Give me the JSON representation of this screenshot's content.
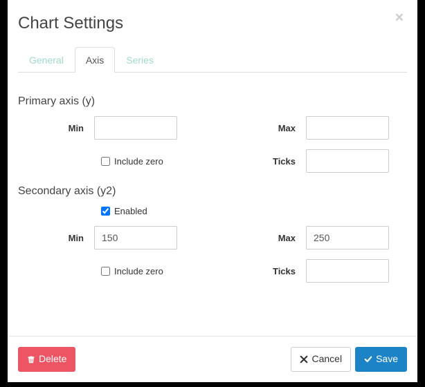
{
  "title": "Chart Settings",
  "tabs": {
    "general": "General",
    "axis": "Axis",
    "series": "Series",
    "active": "axis"
  },
  "primary": {
    "title": "Primary axis (y)",
    "min_label": "Min",
    "min_value": "",
    "max_label": "Max",
    "max_value": "",
    "include_zero_label": "Include zero",
    "include_zero_checked": false,
    "ticks_label": "Ticks",
    "ticks_value": ""
  },
  "secondary": {
    "title": "Secondary axis (y2)",
    "enabled_label": "Enabled",
    "enabled_checked": true,
    "min_label": "Min",
    "min_value": "150",
    "max_label": "Max",
    "max_value": "250",
    "include_zero_label": "Include zero",
    "include_zero_checked": false,
    "ticks_label": "Ticks",
    "ticks_value": ""
  },
  "footer": {
    "delete": "Delete",
    "cancel": "Cancel",
    "save": "Save"
  }
}
